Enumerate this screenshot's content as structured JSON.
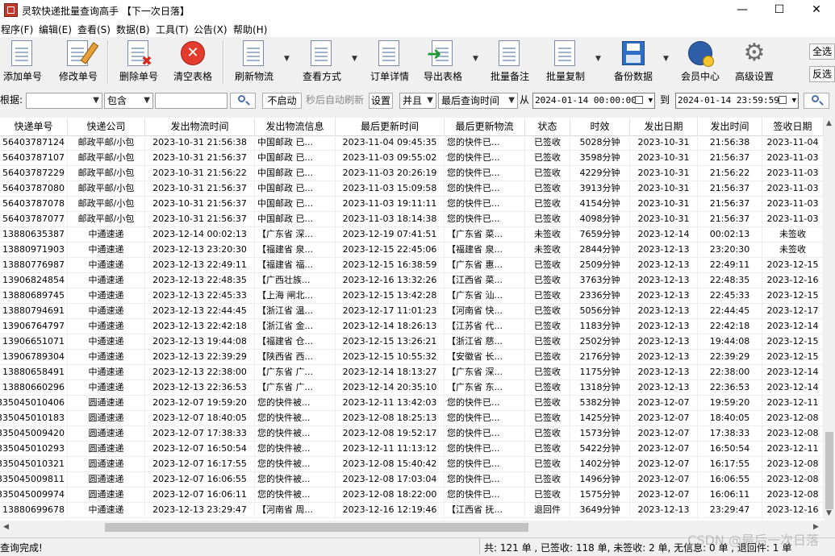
{
  "window": {
    "title": "灵软快递批量查询高手 【下一次日落】",
    "minimize": "—",
    "maximize": "☐",
    "close": "✕"
  },
  "menu": [
    "程序(F)",
    "编辑(E)",
    "查看(S)",
    "数据(B)",
    "工具(T)",
    "公告(X)",
    "帮助(H)"
  ],
  "toolbar": {
    "add": "添加单号",
    "edit": "修改单号",
    "delete": "删除单号",
    "clear": "清空表格",
    "refresh": "刷新物流",
    "view": "查看方式",
    "detail": "订单详情",
    "export": "导出表格",
    "batch_note": "批量备注",
    "batch_copy": "批量复制",
    "backup": "备份数据",
    "member": "会员中心",
    "settings": "高级设置",
    "select_all": "全选",
    "invert": "反选"
  },
  "filter": {
    "by_label": "根据:",
    "by_value": "",
    "match_value": "包含",
    "keyword": "",
    "auto_refresh_btn": "不启动",
    "auto_refresh_text": "秒后自动刷新",
    "settings_btn": "设置",
    "logic_value": "并且",
    "time_field": "最后查询时间",
    "from_label": "从",
    "from_date": "2024-01-14 00:00:00",
    "to_label": "到",
    "to_date": "2024-01-14 23:59:59"
  },
  "table": {
    "columns": [
      "快递单号",
      "快递公司",
      "发出物流时间",
      "发出物流信息",
      "最后更新时间",
      "最后更新物流",
      "状态",
      "时效",
      "发出日期",
      "发出时间",
      "签收日期"
    ],
    "rows": [
      [
        "56403787124",
        "邮政平邮/小包",
        "2023-10-31 21:56:38",
        "中国邮政 已...",
        "2023-11-04 09:45:35",
        "您的快件已...",
        "已签收",
        "5028分钟",
        "2023-10-31",
        "21:56:38",
        "2023-11-04"
      ],
      [
        "56403787107",
        "邮政平邮/小包",
        "2023-10-31 21:56:37",
        "中国邮政 已...",
        "2023-11-03 09:55:02",
        "您的快件已...",
        "已签收",
        "3598分钟",
        "2023-10-31",
        "21:56:37",
        "2023-11-03"
      ],
      [
        "56403787229",
        "邮政平邮/小包",
        "2023-10-31 21:56:22",
        "中国邮政 已...",
        "2023-11-03 20:26:19",
        "您的快件已...",
        "已签收",
        "4229分钟",
        "2023-10-31",
        "21:56:22",
        "2023-11-03"
      ],
      [
        "56403787080",
        "邮政平邮/小包",
        "2023-10-31 21:56:37",
        "中国邮政 已...",
        "2023-11-03 15:09:58",
        "您的快件已...",
        "已签收",
        "3913分钟",
        "2023-10-31",
        "21:56:37",
        "2023-11-03"
      ],
      [
        "56403787078",
        "邮政平邮/小包",
        "2023-10-31 21:56:37",
        "中国邮政 已...",
        "2023-11-03 19:11:11",
        "您的快件已...",
        "已签收",
        "4154分钟",
        "2023-10-31",
        "21:56:37",
        "2023-11-03"
      ],
      [
        "56403787077",
        "邮政平邮/小包",
        "2023-10-31 21:56:37",
        "中国邮政 已...",
        "2023-11-03 18:14:38",
        "您的快件已...",
        "已签收",
        "4098分钟",
        "2023-10-31",
        "21:56:37",
        "2023-11-03"
      ],
      [
        "13880635387",
        "中通速递",
        "2023-12-14 00:02:13",
        "【广东省 深...",
        "2023-12-19 07:41:51",
        "【广东省 菜...",
        "未签收",
        "7659分钟",
        "2023-12-14",
        "00:02:13",
        "未签收"
      ],
      [
        "13880971903",
        "中通速递",
        "2023-12-13 23:20:30",
        "【福建省 泉...",
        "2023-12-15 22:45:06",
        "【福建省 泉...",
        "未签收",
        "2844分钟",
        "2023-12-13",
        "23:20:30",
        "未签收"
      ],
      [
        "13880776987",
        "中通速递",
        "2023-12-13 22:49:11",
        "【福建省 福...",
        "2023-12-15 16:38:59",
        "【广东省 惠...",
        "已签收",
        "2509分钟",
        "2023-12-13",
        "22:49:11",
        "2023-12-15"
      ],
      [
        "13906824854",
        "中通速递",
        "2023-12-13 22:48:35",
        "【广西壮族...",
        "2023-12-16 13:32:26",
        "【江西省 菜...",
        "已签收",
        "3763分钟",
        "2023-12-13",
        "22:48:35",
        "2023-12-16"
      ],
      [
        "13880689745",
        "中通速递",
        "2023-12-13 22:45:33",
        "【上海 闸北...",
        "2023-12-15 13:42:28",
        "【广东省 汕...",
        "已签收",
        "2336分钟",
        "2023-12-13",
        "22:45:33",
        "2023-12-15"
      ],
      [
        "13880794691",
        "中通速递",
        "2023-12-13 22:44:45",
        "【浙江省 温...",
        "2023-12-17 11:01:23",
        "【河南省 快...",
        "已签收",
        "5056分钟",
        "2023-12-13",
        "22:44:45",
        "2023-12-17"
      ],
      [
        "13906764797",
        "中通速递",
        "2023-12-13 22:42:18",
        "【浙江省 金...",
        "2023-12-14 18:26:13",
        "【江苏省 代...",
        "已签收",
        "1183分钟",
        "2023-12-13",
        "22:42:18",
        "2023-12-14"
      ],
      [
        "13906651071",
        "中通速递",
        "2023-12-13 19:44:08",
        "【福建省 仓...",
        "2023-12-15 13:26:21",
        "【浙江省 慈...",
        "已签收",
        "2502分钟",
        "2023-12-13",
        "19:44:08",
        "2023-12-15"
      ],
      [
        "13906789304",
        "中通速递",
        "2023-12-13 22:39:29",
        "【陕西省 西...",
        "2023-12-15 10:55:32",
        "【安徽省 长...",
        "已签收",
        "2176分钟",
        "2023-12-13",
        "22:39:29",
        "2023-12-15"
      ],
      [
        "13880658491",
        "中通速递",
        "2023-12-13 22:38:00",
        "【广东省 广...",
        "2023-12-14 18:13:27",
        "【广东省 深...",
        "已签收",
        "1175分钟",
        "2023-12-13",
        "22:38:00",
        "2023-12-14"
      ],
      [
        "13880660296",
        "中通速递",
        "2023-12-13 22:36:53",
        "【广东省 广...",
        "2023-12-14 20:35:10",
        "【广东省 东...",
        "已签收",
        "1318分钟",
        "2023-12-13",
        "22:36:53",
        "2023-12-14"
      ],
      [
        "335045010406",
        "圆通速递",
        "2023-12-07 19:59:20",
        "您的快件被...",
        "2023-12-11 13:42:03",
        "您的快件已...",
        "已签收",
        "5382分钟",
        "2023-12-07",
        "19:59:20",
        "2023-12-11"
      ],
      [
        "335045010183",
        "圆通速递",
        "2023-12-07 18:40:05",
        "您的快件被...",
        "2023-12-08 18:25:13",
        "您的快件已...",
        "已签收",
        "1425分钟",
        "2023-12-07",
        "18:40:05",
        "2023-12-08"
      ],
      [
        "335045009420",
        "圆通速递",
        "2023-12-07 17:38:33",
        "您的快件被...",
        "2023-12-08 19:52:17",
        "您的快件已...",
        "已签收",
        "1573分钟",
        "2023-12-07",
        "17:38:33",
        "2023-12-08"
      ],
      [
        "335045010293",
        "圆通速递",
        "2023-12-07 16:50:54",
        "您的快件被...",
        "2023-12-11 11:13:12",
        "您的快件已...",
        "已签收",
        "5422分钟",
        "2023-12-07",
        "16:50:54",
        "2023-12-11"
      ],
      [
        "335045010321",
        "圆通速递",
        "2023-12-07 16:17:55",
        "您的快件被...",
        "2023-12-08 15:40:42",
        "您的快件已...",
        "已签收",
        "1402分钟",
        "2023-12-07",
        "16:17:55",
        "2023-12-08"
      ],
      [
        "335045009811",
        "圆通速递",
        "2023-12-07 16:06:55",
        "您的快件被...",
        "2023-12-08 17:03:04",
        "您的快件已...",
        "已签收",
        "1496分钟",
        "2023-12-07",
        "16:06:55",
        "2023-12-08"
      ],
      [
        "335045009974",
        "圆通速递",
        "2023-12-07 16:06:11",
        "您的快件被...",
        "2023-12-08 18:22:00",
        "您的快件已...",
        "已签收",
        "1575分钟",
        "2023-12-07",
        "16:06:11",
        "2023-12-08"
      ],
      [
        "13880699678",
        "中通速递",
        "2023-12-13 23:29:47",
        "【河南省 周...",
        "2023-12-16 12:19:46",
        "【江西省 抚...",
        "退回件",
        "3649分钟",
        "2023-12-13",
        "23:29:47",
        "2023-12-16"
      ]
    ]
  },
  "status": {
    "left": "查询完成!",
    "summary": "共: 121 单 , 已签收:  118 单, 未签收:  2 单, 无信息: 0 单 , 退回件: 1 单"
  },
  "watermark": "CSDN @最后一次日落"
}
